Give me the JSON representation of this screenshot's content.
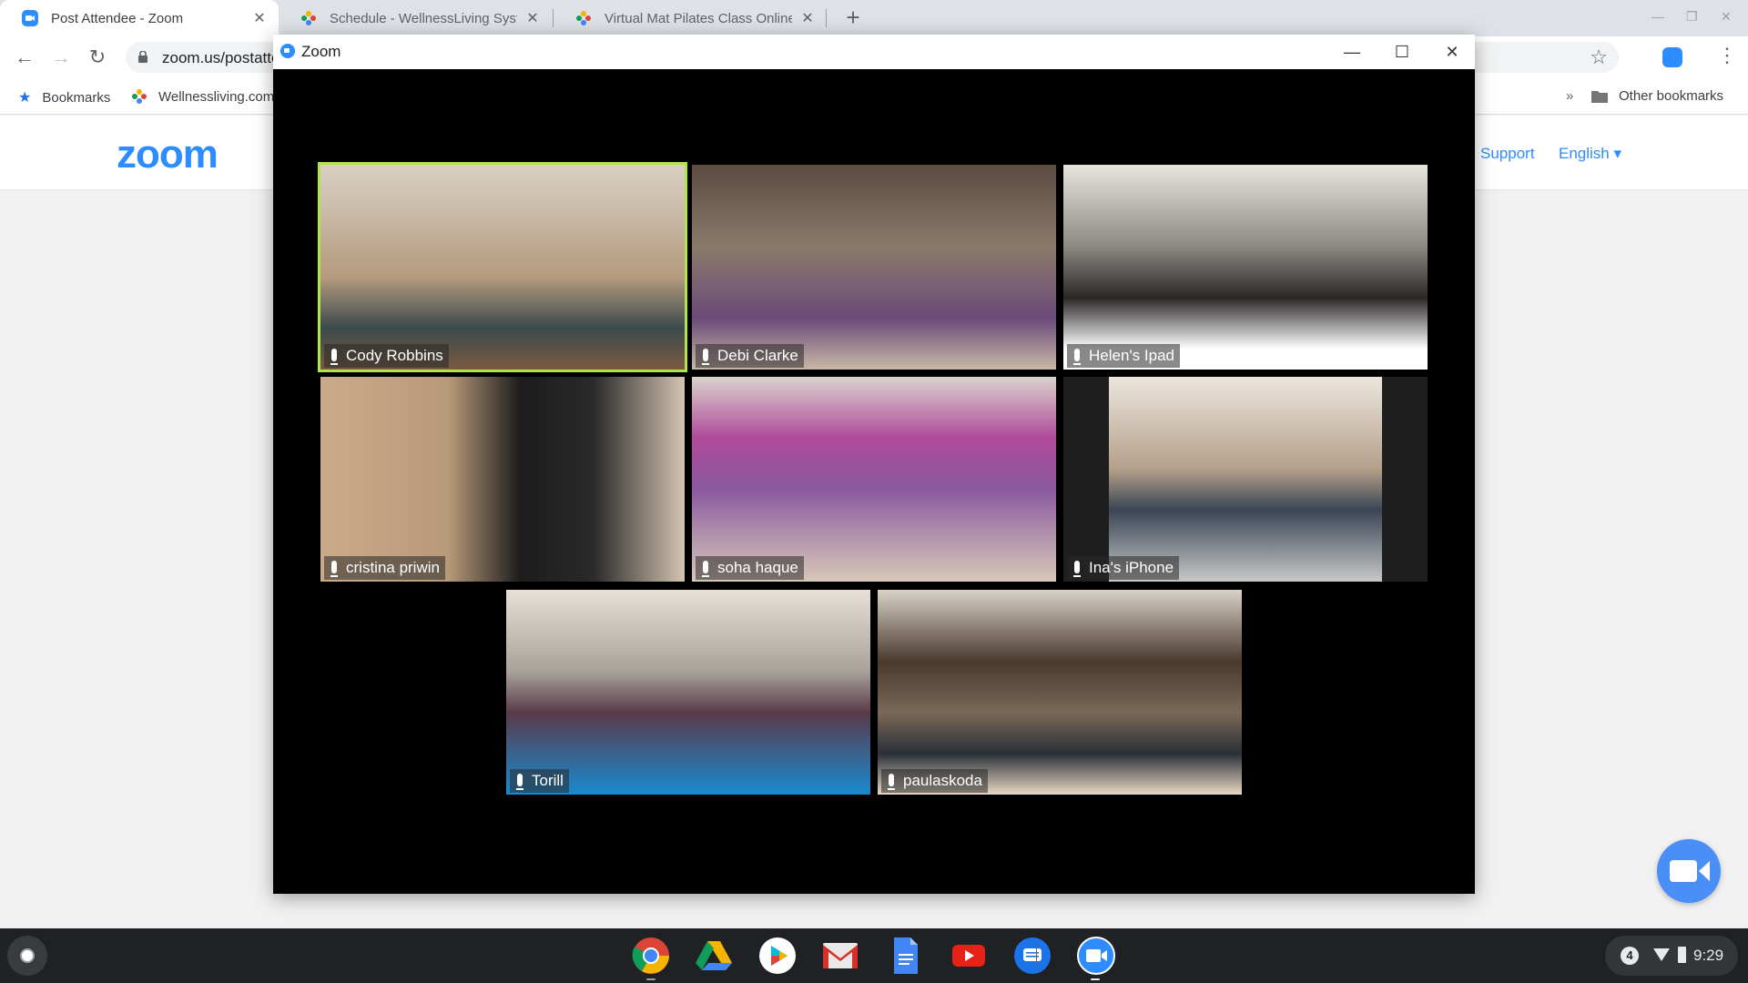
{
  "browser": {
    "tabs": [
      {
        "title": "Post Attendee - Zoom",
        "favicon": "zoom-icon",
        "active": true
      },
      {
        "title": "Schedule - WellnessLiving System",
        "favicon": "wellnessliving-icon",
        "active": false
      },
      {
        "title": "Virtual Mat Pilates Class Online - ",
        "favicon": "wellnessliving-icon",
        "active": false
      }
    ],
    "tab_close_glyph": "✕",
    "new_tab_glyph": "+",
    "url": "zoom.us/postattendee",
    "nav": {
      "back": "←",
      "forward": "→",
      "reload": "↻"
    },
    "star_glyph": "☆",
    "menu_glyph": "⋮",
    "bookmarks": {
      "items": [
        {
          "label": "Bookmarks",
          "icon": "star-icon"
        },
        {
          "label": "Wellnessliving.com",
          "icon": "wellnessliving-icon"
        }
      ],
      "overflow_glyph": "»",
      "other_label": "Other bookmarks"
    }
  },
  "webpage": {
    "logo": "zoom",
    "links": [
      {
        "label": "Support"
      },
      {
        "label": "English ▾"
      }
    ],
    "accent": "#2d8cff"
  },
  "zoom_window": {
    "title": "Zoom",
    "controls": {
      "minimize": "—",
      "maximize": "☐",
      "close": "✕"
    },
    "participants": [
      {
        "name": "Cody Robbins",
        "active_speaker": true
      },
      {
        "name": "Debi Clarke",
        "active_speaker": false
      },
      {
        "name": "Helen's Ipad",
        "active_speaker": false
      },
      {
        "name": "cristina priwin",
        "active_speaker": false
      },
      {
        "name": "soha haque",
        "active_speaker": false
      },
      {
        "name": "Ina's iPhone",
        "active_speaker": false
      },
      {
        "name": "Torill",
        "active_speaker": false
      },
      {
        "name": "paulaskoda",
        "active_speaker": false
      }
    ],
    "active_speaker_color": "#b3e34c"
  },
  "shelf": {
    "apps": [
      {
        "name": "Chrome",
        "running": true
      },
      {
        "name": "Google Drive",
        "running": false
      },
      {
        "name": "Play Store",
        "running": false
      },
      {
        "name": "Gmail",
        "running": false
      },
      {
        "name": "Google Docs",
        "running": false
      },
      {
        "name": "YouTube",
        "running": false
      },
      {
        "name": "Messages",
        "running": false
      },
      {
        "name": "Zoom",
        "running": true
      }
    ],
    "tray": {
      "notifications": "4",
      "time": "9:29"
    }
  }
}
